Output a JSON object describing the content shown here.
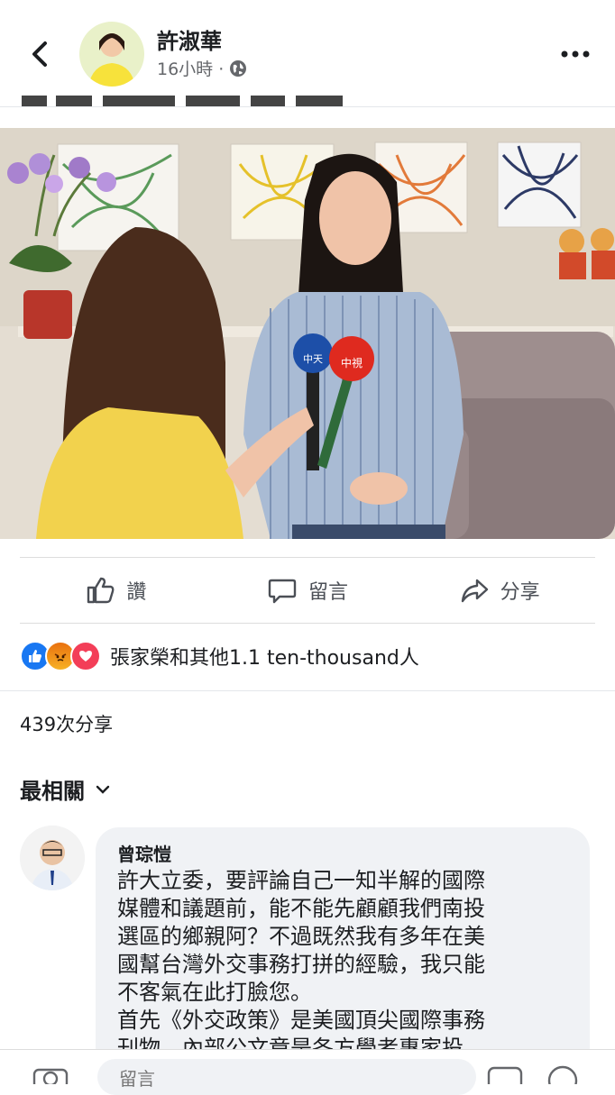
{
  "header": {
    "author": "許淑華",
    "time": "16小時 ·",
    "back_icon": "chevron-left-icon",
    "privacy_icon": "globe-icon",
    "more_icon": "more-horizontal-icon"
  },
  "actions": {
    "like": "讚",
    "comment": "留言",
    "share": "分享"
  },
  "reactions": {
    "summary": "張家榮和其他1.1 ten-thousand人",
    "icons": [
      "like-reaction-icon",
      "angry-reaction-icon",
      "love-reaction-icon"
    ],
    "colors": {
      "like": "#1877f2",
      "angry": "#f7b125",
      "love": "#f33e58"
    }
  },
  "stats": {
    "shares": "439次分享"
  },
  "comments": {
    "sort_label": "最相關",
    "items": [
      {
        "name": "曾琮愷",
        "lines": [
          "許大立委，要評論自己一知半解的國際",
          "媒體和議題前，能不能先顧顧我們南投",
          "選區的鄉親阿？不過既然我有多年在美",
          "國幫台灣外交事務打拼的經驗，我只能",
          "不客氣在此打臉您。",
          "首先《外交政策》是美國頂尖國際事務",
          "刊物，內部公文章是各方學者專家投"
        ]
      }
    ]
  },
  "composer": {
    "placeholder": "留言"
  },
  "photo": {
    "mic_labels": [
      "中天",
      "中視"
    ]
  }
}
